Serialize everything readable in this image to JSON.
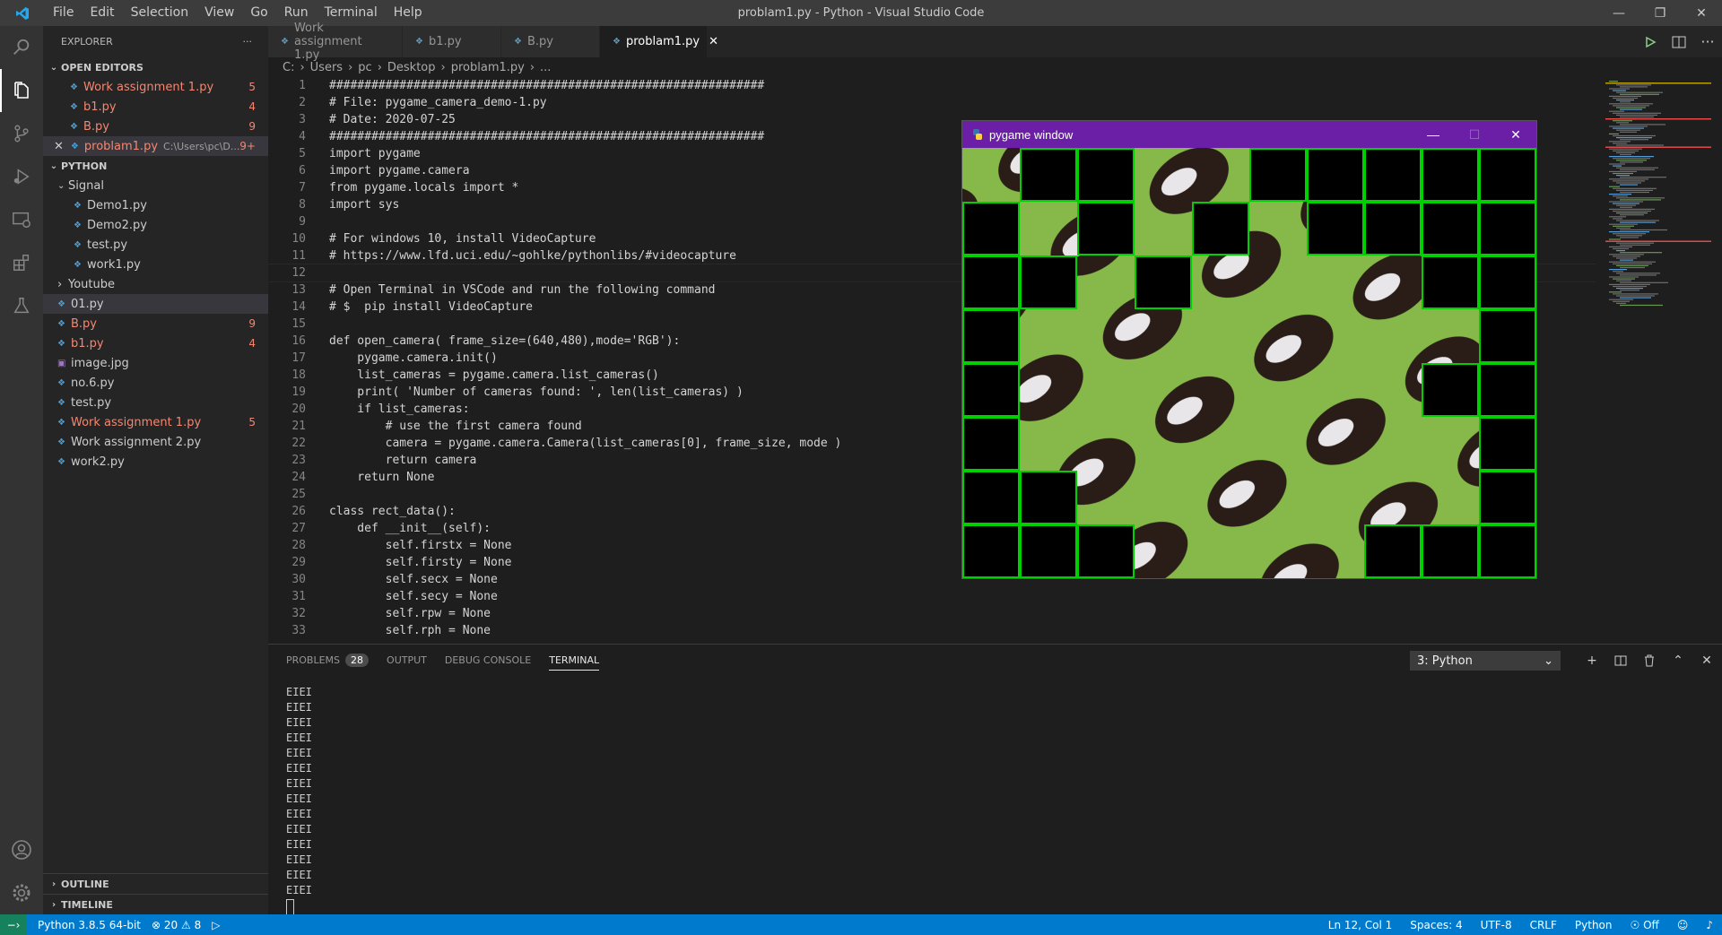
{
  "window": {
    "title": "problam1.py - Python - Visual Studio Code",
    "menu": [
      "File",
      "Edit",
      "Selection",
      "View",
      "Go",
      "Run",
      "Terminal",
      "Help"
    ]
  },
  "explorer": {
    "header": "EXPLORER",
    "open_editors_title": "OPEN EDITORS",
    "open_editors": [
      {
        "name": "Work assignment 1.py",
        "badge": "5",
        "error": true
      },
      {
        "name": "b1.py",
        "badge": "4",
        "error": true
      },
      {
        "name": "B.py",
        "badge": "9",
        "error": true
      },
      {
        "name": "problam1.py",
        "path": "C:\\Users\\pc\\D...",
        "badge": "9+",
        "error": true,
        "active": true
      }
    ],
    "folder_title": "PYTHON",
    "tree": [
      {
        "name": "Signal",
        "type": "folder-open",
        "depth": 0
      },
      {
        "name": "Demo1.py",
        "depth": 1
      },
      {
        "name": "Demo2.py",
        "depth": 1
      },
      {
        "name": "test.py",
        "depth": 1
      },
      {
        "name": "work1.py",
        "depth": 1
      },
      {
        "name": "Youtube",
        "type": "folder",
        "depth": 0
      },
      {
        "name": "01.py",
        "depth": 0,
        "selected": true
      },
      {
        "name": "B.py",
        "depth": 0,
        "badge": "9",
        "error": true
      },
      {
        "name": "b1.py",
        "depth": 0,
        "badge": "4",
        "error": true
      },
      {
        "name": "image.jpg",
        "depth": 0
      },
      {
        "name": "no.6.py",
        "depth": 0
      },
      {
        "name": "test.py",
        "depth": 0
      },
      {
        "name": "Work assignment 1.py",
        "depth": 0,
        "badge": "5",
        "error": true
      },
      {
        "name": "Work assignment 2.py",
        "depth": 0
      },
      {
        "name": "work2.py",
        "depth": 0
      }
    ],
    "outline_title": "OUTLINE",
    "timeline_title": "TIMELINE"
  },
  "tabs": [
    {
      "label": "Work assignment 1.py"
    },
    {
      "label": "b1.py"
    },
    {
      "label": "B.py"
    },
    {
      "label": "problam1.py",
      "active": true
    }
  ],
  "breadcrumb": [
    "C:",
    "Users",
    "pc",
    "Desktop",
    "problam1.py",
    "..."
  ],
  "code_lines": [
    "##############################################################",
    "# File: pygame_camera_demo-1.py",
    "# Date: 2020-07-25",
    "##############################################################",
    "import pygame",
    "import pygame.camera",
    "from pygame.locals import *",
    "import sys",
    "",
    "# For windows 10, install VideoCapture",
    "# https://www.lfd.uci.edu/~gohlke/pythonlibs/#videocapture",
    "",
    "# Open Terminal in VSCode and run the following command",
    "# $  pip install VideoCapture",
    "",
    "def open_camera( frame_size=(640,480),mode='RGB'):",
    "    pygame.camera.init()",
    "    list_cameras = pygame.camera.list_cameras()",
    "    print( 'Number of cameras found: ', len(list_cameras) )",
    "    if list_cameras:",
    "        # use the first camera found",
    "        camera = pygame.camera.Camera(list_cameras[0], frame_size, mode )",
    "        return camera",
    "    return None",
    "",
    "class rect_data():",
    "    def __init__(self):",
    "        self.firstx = None",
    "        self.firsty = None",
    "        self.secx = None",
    "        self.secy = None",
    "        self.rpw = None",
    "        self.rph = None"
  ],
  "panel": {
    "tabs": [
      "PROBLEMS",
      "OUTPUT",
      "DEBUG CONSOLE",
      "TERMINAL"
    ],
    "problems_count": "28",
    "active_tab": "TERMINAL",
    "terminal_select": "3: Python",
    "terminal_lines": [
      "EIEI",
      "EIEI",
      "EIEI",
      "EIEI",
      "EIEI",
      "EIEI",
      "EIEI",
      "EIEI",
      "EIEI",
      "EIEI",
      "EIEI",
      "EIEI",
      "EIEI",
      "EIEI"
    ]
  },
  "pygame_window": {
    "title": "pygame window",
    "grid_cols": 10,
    "grid_rows": 8,
    "black_cells": [
      [
        0,
        1
      ],
      [
        0,
        2
      ],
      [
        0,
        5
      ],
      [
        0,
        6
      ],
      [
        0,
        7
      ],
      [
        0,
        8
      ],
      [
        0,
        9
      ],
      [
        1,
        0
      ],
      [
        1,
        2
      ],
      [
        1,
        4
      ],
      [
        1,
        6
      ],
      [
        1,
        7
      ],
      [
        1,
        8
      ],
      [
        1,
        9
      ],
      [
        2,
        0
      ],
      [
        2,
        1
      ],
      [
        2,
        3
      ],
      [
        2,
        8
      ],
      [
        2,
        9
      ],
      [
        3,
        0
      ],
      [
        3,
        9
      ],
      [
        4,
        0
      ],
      [
        4,
        8
      ],
      [
        4,
        9
      ],
      [
        5,
        0
      ],
      [
        5,
        9
      ],
      [
        6,
        0
      ],
      [
        6,
        1
      ],
      [
        6,
        9
      ],
      [
        7,
        0
      ],
      [
        7,
        1
      ],
      [
        7,
        2
      ],
      [
        7,
        7
      ],
      [
        7,
        8
      ],
      [
        7,
        9
      ]
    ],
    "grid_color": "#00d000",
    "title_color": "#6b1fa6"
  },
  "status": {
    "interpreter": "Python 3.8.5 64-bit",
    "errors": "20",
    "warnings": "8",
    "position": "Ln 12, Col 1",
    "spaces": "Spaces: 4",
    "encoding": "UTF-8",
    "eol": "CRLF",
    "language": "Python",
    "live_share": "Off"
  },
  "colors": {
    "accent": "#007acc",
    "error": "#f48771"
  }
}
